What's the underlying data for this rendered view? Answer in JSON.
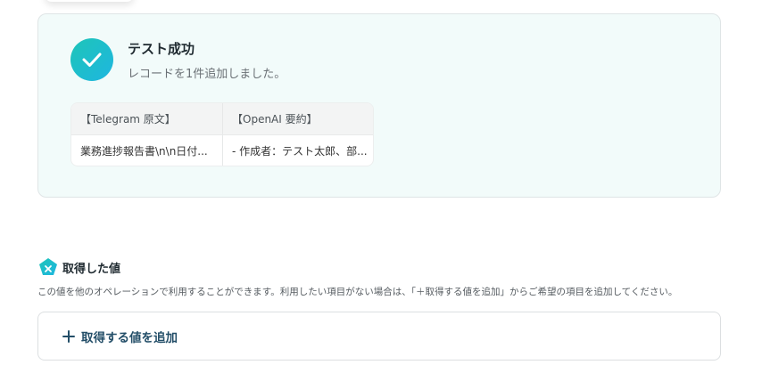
{
  "result": {
    "title": "テスト成功",
    "subtitle": "レコードを1件追加しました。",
    "table": {
      "headers": [
        "【Telegram 原文】",
        "【OpenAI 要約】"
      ],
      "rows": [
        [
          "業務進捗報告書\\n\\n日付...",
          "- 作成者：テスト太郎、部..."
        ]
      ]
    }
  },
  "acquired": {
    "title": "取得した値",
    "description": "この値を他のオペレーションで利用することができます。利用したい項目がない場合は、「＋取得する値を追加」からご希望の項目を追加してください。",
    "add_label": "取得する値を追加"
  },
  "colors": {
    "accent_gradient_start": "#1dc5b8",
    "accent_gradient_end": "#1fb6e0",
    "add_label": "#234e68",
    "card_bg": "#f2fbfa"
  }
}
